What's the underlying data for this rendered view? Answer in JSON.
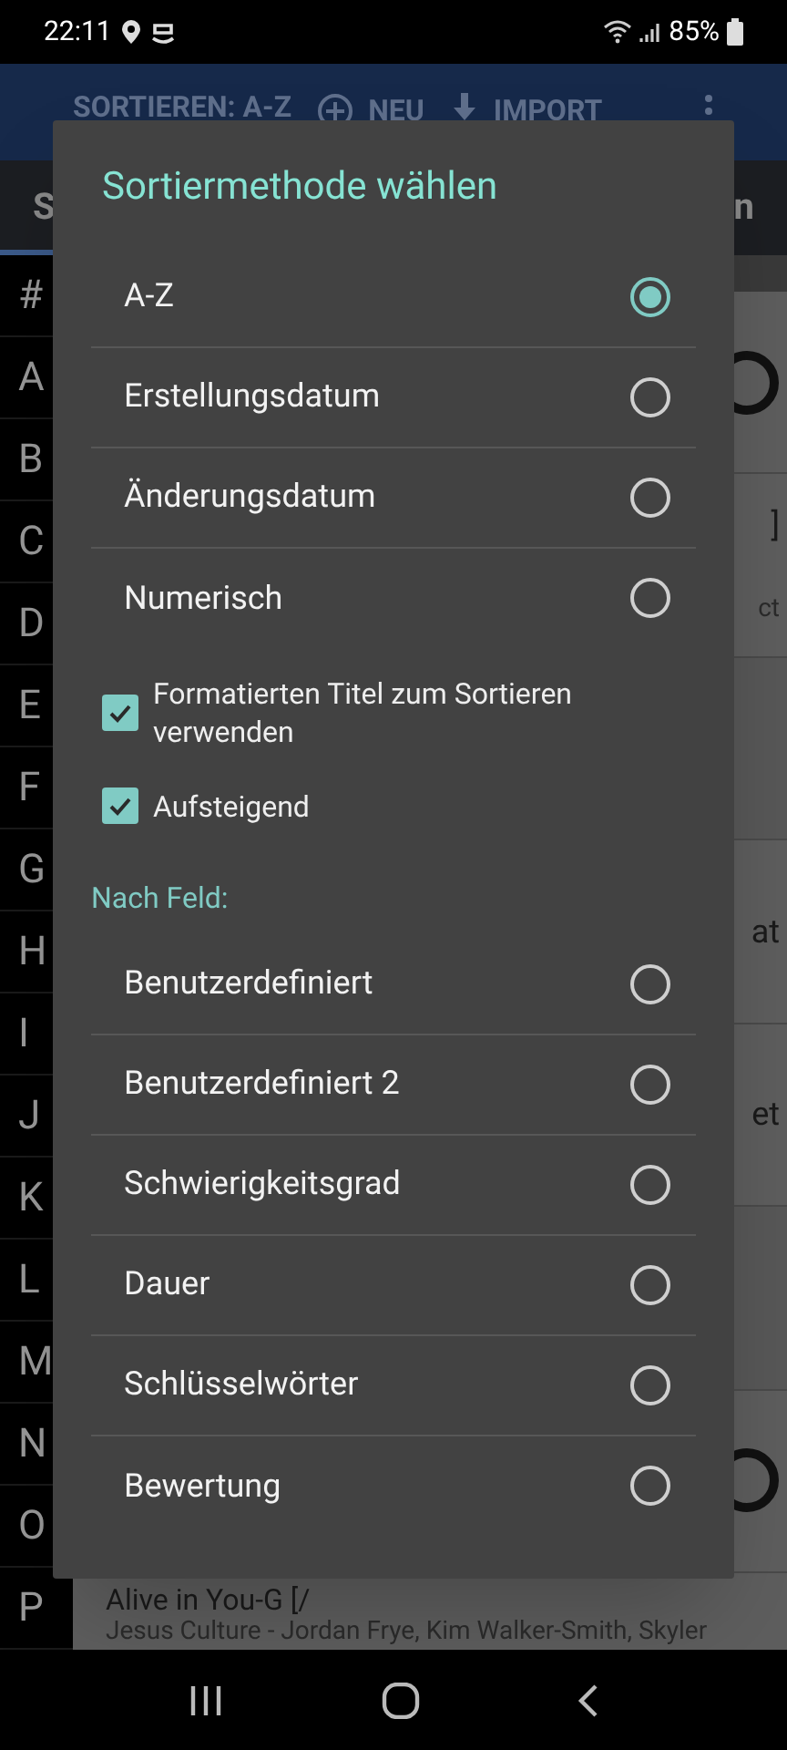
{
  "status_bar": {
    "time": "22:11",
    "battery": "85%"
  },
  "toolbar": {
    "actions": [
      {
        "label": "SORTIEREN: A-Z",
        "kind": "text"
      },
      {
        "label": "NEU",
        "kind": "add"
      },
      {
        "label": "IMPORT",
        "kind": "download"
      }
    ]
  },
  "tabs": [
    {
      "label": "S",
      "selected": true
    },
    {
      "label": "n",
      "selected": false
    }
  ],
  "index": [
    "#",
    "A",
    "B",
    "C",
    "D",
    "E",
    "F",
    "G",
    "H",
    "I",
    "J",
    "K",
    "L",
    "M",
    "N",
    "O",
    "P"
  ],
  "list_rows": [
    {
      "kind": "icon"
    },
    {
      "kind": "text",
      "tail": "]",
      "sub": "ct"
    },
    {
      "kind": "blank"
    },
    {
      "kind": "text",
      "tail": "at"
    },
    {
      "kind": "text",
      "tail": "et"
    },
    {
      "kind": "blank"
    },
    {
      "kind": "icon"
    }
  ],
  "last_row": {
    "title": "Alive in You-G  [/",
    "subtitle": "Jesus Culture - Jordan Frye, Kim Walker-Smith, Skyler"
  },
  "dialog": {
    "title": "Sortiermethode wählen",
    "methods": [
      {
        "label": "A-Z",
        "selected": true
      },
      {
        "label": "Erstellungsdatum",
        "selected": false
      },
      {
        "label": "Änderungsdatum",
        "selected": false
      },
      {
        "label": "Numerisch",
        "selected": false
      }
    ],
    "options": [
      {
        "label": "Formatierten Titel zum Sortieren verwenden",
        "checked": true
      },
      {
        "label": "Aufsteigend",
        "checked": true
      }
    ],
    "field_heading": "Nach Feld:",
    "fields": [
      {
        "label": "Benutzerdefiniert",
        "selected": false
      },
      {
        "label": "Benutzerdefiniert 2",
        "selected": false
      },
      {
        "label": "Schwierigkeitsgrad",
        "selected": false
      },
      {
        "label": "Dauer",
        "selected": false
      },
      {
        "label": "Schlüsselwörter",
        "selected": false
      },
      {
        "label": "Bewertung",
        "selected": false
      }
    ]
  }
}
